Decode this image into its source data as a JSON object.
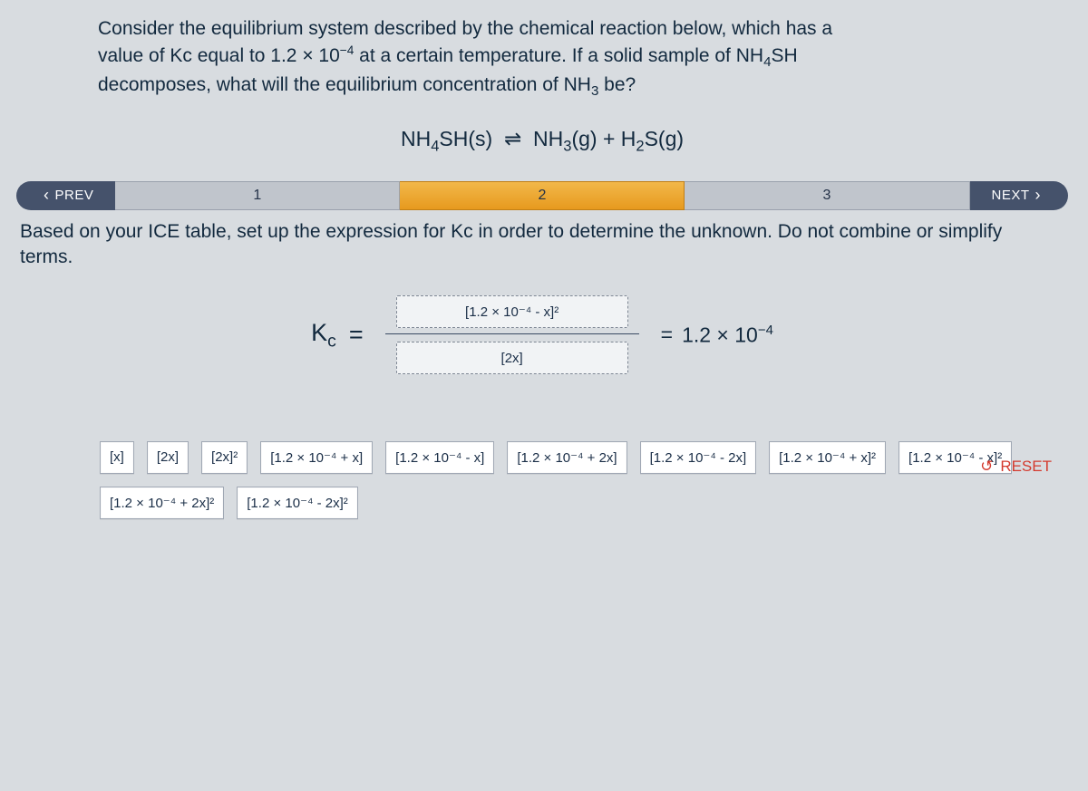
{
  "question": {
    "l1_a": "Consider the equilibrium system described by the chemical reaction below, which has a",
    "l2_a": "value of Kc equal to 1.2 × 10",
    "l2_exp": "−4",
    "l2_b": " at a certain temperature. If a solid sample of NH",
    "l2_c": "SH",
    "l3_a": "decomposes, what will the equilibrium concentration of NH",
    "l3_b": " be?"
  },
  "equation": {
    "lhs_a": "NH",
    "lhs_b": "SH(s)",
    "arrow": "⇌",
    "rhs_a": "NH",
    "rhs_b": "(g) + H",
    "rhs_c": "S(g)"
  },
  "nav": {
    "prev": "PREV",
    "p1": "1",
    "p2": "2",
    "p3": "3",
    "next": "NEXT"
  },
  "instruction": "Based on your ICE table, set up the expression for Kc in order to determine the unknown. Do not combine or simplify terms.",
  "kc": {
    "sym": "K",
    "sub": "c",
    "eq": "=",
    "num_current": "[1.2 × 10⁻⁴ - x]²",
    "den_current": "[2x]",
    "rhs_eq": "=",
    "rhs_val_a": "1.2 × 10",
    "rhs_exp": "−4"
  },
  "reset": "RESET",
  "tiles": {
    "t0": "[x]",
    "t1": "[2x]",
    "t2": "[2x]²",
    "t3": "[1.2 × 10⁻⁴ + x]",
    "t4": "[1.2 × 10⁻⁴ - x]",
    "t5": "[1.2 × 10⁻⁴ + 2x]",
    "t6": "[1.2 × 10⁻⁴ - 2x]",
    "t7": "[1.2 × 10⁻⁴ + x]²",
    "t8": "[1.2 × 10⁻⁴ - x]²",
    "t9": "[1.2 × 10⁻⁴ + 2x]²",
    "t10": "[1.2 × 10⁻⁴ - 2x]²"
  }
}
